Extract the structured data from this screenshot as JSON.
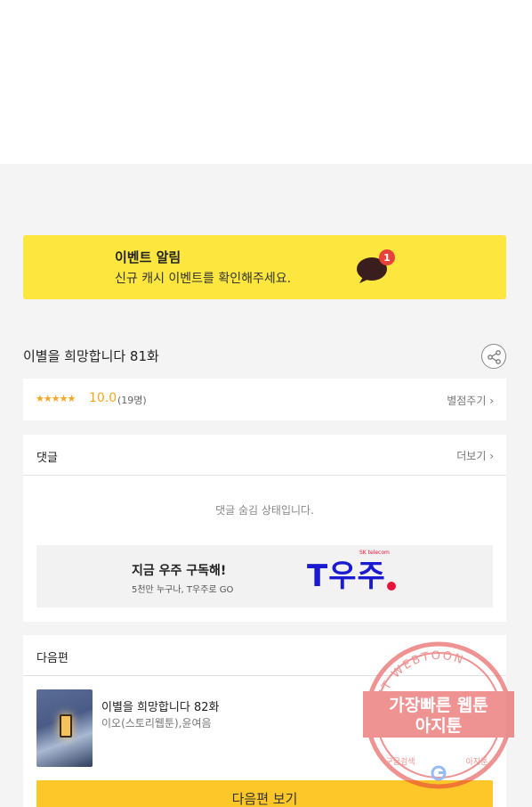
{
  "event": {
    "title": "이벤트 알림",
    "description": "신규 캐시 이벤트를 확인해주세요.",
    "badge_count": "1",
    "icon": "chat-bubble-icon"
  },
  "episode": {
    "title": "이별을 희망합니다 81화",
    "share_icon": "share-icon"
  },
  "rating": {
    "stars": "★★★★★",
    "score": "10.0",
    "count": "(19명)",
    "rate_label": "별점주기 ›"
  },
  "comments": {
    "title": "댓글",
    "more_label": "더보기 ›",
    "hidden_message": "댓글 숨김 상태입니다."
  },
  "ad": {
    "headline": "지금 우주 구독해!",
    "subtext": "5천만 누구나, T우주로 GO",
    "logo_text": "T우주",
    "sk_text": "SK telecom"
  },
  "next_episode": {
    "section_title": "다음편",
    "title": "이별을 희망합니다 82화",
    "author": "이오(스토리웹툰),윤여음",
    "button_label": "다음편 보기"
  },
  "watermark": {
    "top_arc": "AGIT WEBTOON",
    "line1": "가장빠른 웹툰",
    "line2": "아지툰",
    "bottom_left": "구글검색",
    "bottom_right": "아지툰"
  },
  "colors": {
    "event_bg": "#fde73e",
    "star": "#f5a623",
    "button": "#fdc629",
    "logo_blue": "#1a1ad0",
    "badge_red": "#e8433a"
  }
}
